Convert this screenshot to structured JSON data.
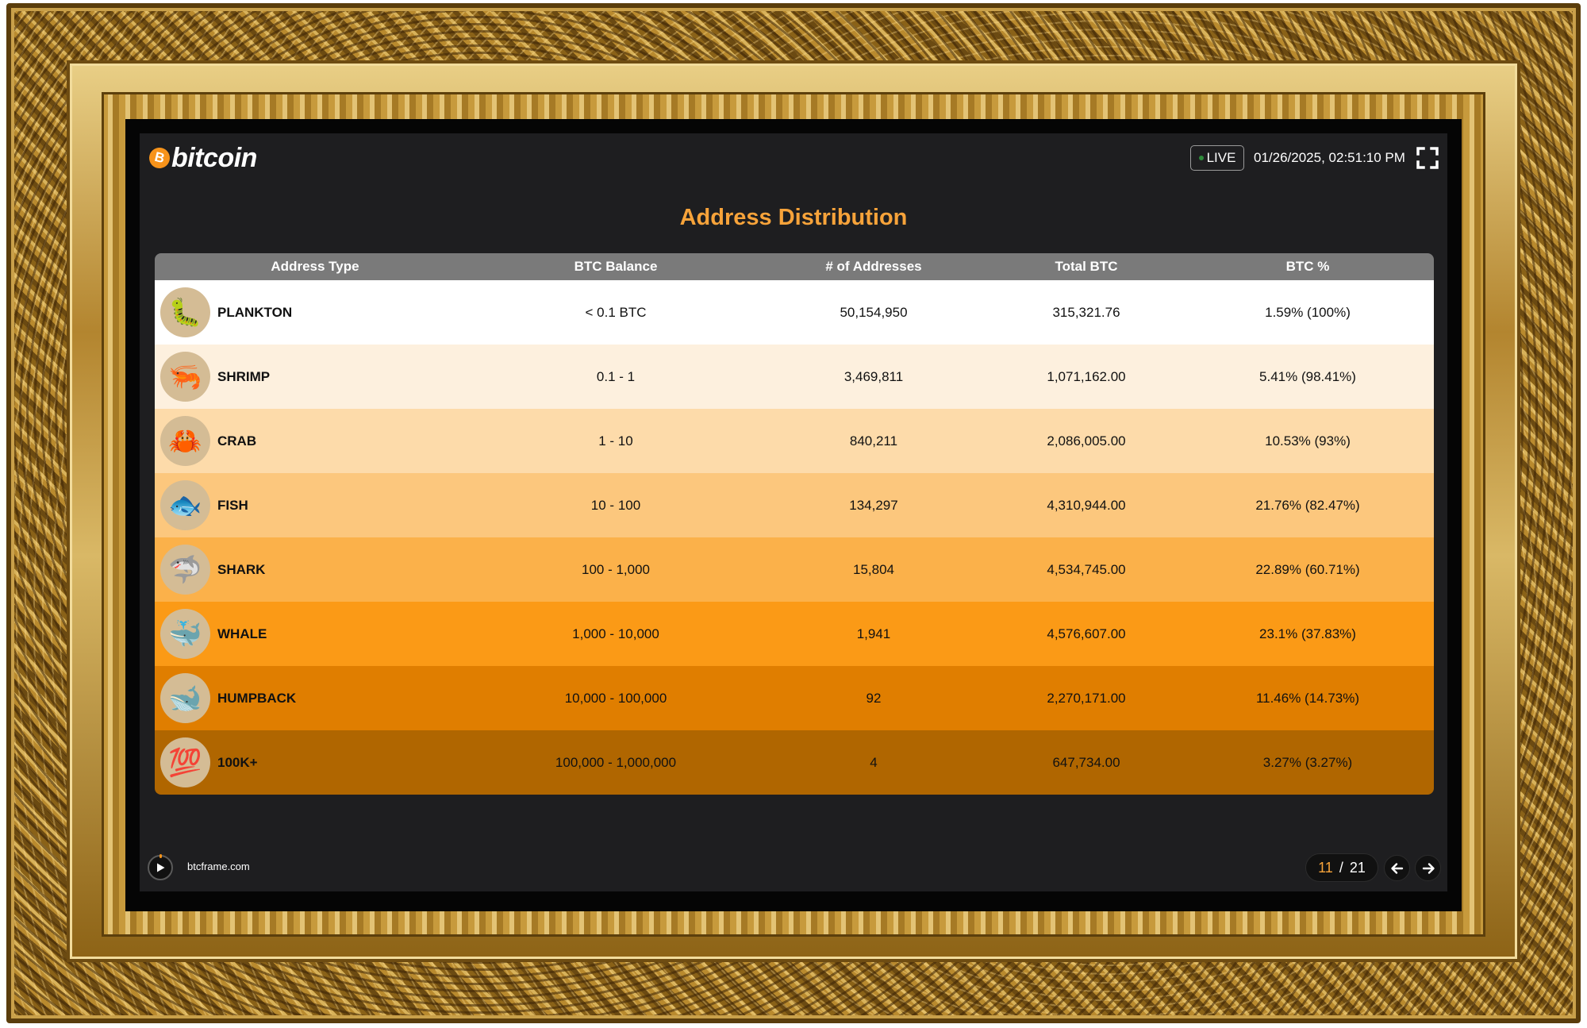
{
  "header": {
    "logo_coin": "B",
    "logo_text": "bitcoin",
    "live_label": "LIVE",
    "timestamp": "01/26/2025, 02:51:10 PM"
  },
  "title": "Address Distribution",
  "table": {
    "columns": [
      "Address Type",
      "BTC Balance",
      "# of Addresses",
      "Total BTC",
      "BTC %"
    ],
    "rows": [
      {
        "icon": "caterpillar-icon",
        "emoji": "🐛",
        "type": "PLANKTON",
        "balance": "< 0.1 BTC",
        "addresses": "50,154,950",
        "total": "315,321.76",
        "percent": "1.59% (100%)"
      },
      {
        "icon": "shrimp-icon",
        "emoji": "🦐",
        "type": "SHRIMP",
        "balance": "0.1 - 1",
        "addresses": "3,469,811",
        "total": "1,071,162.00",
        "percent": "5.41% (98.41%)"
      },
      {
        "icon": "crab-icon",
        "emoji": "🦀",
        "type": "CRAB",
        "balance": "1 - 10",
        "addresses": "840,211",
        "total": "2,086,005.00",
        "percent": "10.53% (93%)"
      },
      {
        "icon": "fish-icon",
        "emoji": "🐟",
        "type": "FISH",
        "balance": "10 - 100",
        "addresses": "134,297",
        "total": "4,310,944.00",
        "percent": "21.76% (82.47%)"
      },
      {
        "icon": "shark-icon",
        "emoji": "🦈",
        "type": "SHARK",
        "balance": "100 - 1,000",
        "addresses": "15,804",
        "total": "4,534,745.00",
        "percent": "22.89% (60.71%)"
      },
      {
        "icon": "whale-icon",
        "emoji": "🐳",
        "type": "WHALE",
        "balance": "1,000 - 10,000",
        "addresses": "1,941",
        "total": "4,576,607.00",
        "percent": "23.1% (37.83%)"
      },
      {
        "icon": "humpback-icon",
        "emoji": "🐋",
        "type": "HUMPBACK",
        "balance": "10,000 - 100,000",
        "addresses": "92",
        "total": "2,270,171.00",
        "percent": "11.46% (14.73%)"
      },
      {
        "icon": "hundred-points-icon",
        "emoji": "💯",
        "type": "100K+",
        "balance": "100,000 - 1,000,000",
        "addresses": "4",
        "total": "647,734.00",
        "percent": "3.27% (3.27%)"
      }
    ]
  },
  "footer": {
    "site": "btcframe.com",
    "page_current": "11",
    "page_sep": "/",
    "page_total": "21"
  },
  "colors": {
    "accent": "#f7a33a",
    "bitcoin_orange": "#f7931a",
    "background": "#1e1e20",
    "header_row": "#7a7a7a",
    "row_shades": [
      "#ffffff",
      "#fdf0de",
      "#fddbaa",
      "#fcc77d",
      "#fbb14a",
      "#fb9a16",
      "#e07e00",
      "#b06600"
    ]
  }
}
